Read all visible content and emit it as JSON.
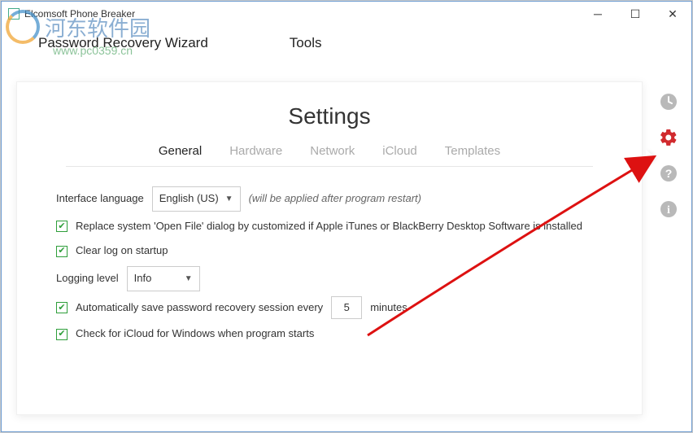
{
  "window": {
    "title": "Elcomsoft Phone Breaker"
  },
  "menubar": {
    "recovery": "Password Recovery Wizard",
    "tools": "Tools"
  },
  "page": {
    "title": "Settings"
  },
  "tabs": {
    "general": "General",
    "hardware": "Hardware",
    "network": "Network",
    "icloud": "iCloud",
    "templates": "Templates"
  },
  "settings": {
    "language_label": "Interface language",
    "language_value": "English (US)",
    "language_hint": "(will be applied after program restart)",
    "replace_dialog": "Replace system 'Open File' dialog by customized if Apple iTunes or BlackBerry Desktop Software is installed",
    "clear_log": "Clear log on startup",
    "logging_label": "Logging level",
    "logging_value": "Info",
    "autosave_prefix": "Automatically save password recovery session every",
    "autosave_value": "5",
    "autosave_suffix": "minutes",
    "check_icloud": "Check for iCloud for Windows when program starts"
  },
  "watermark": {
    "text": "河东软件园",
    "url": "www.pc0359.cn"
  }
}
